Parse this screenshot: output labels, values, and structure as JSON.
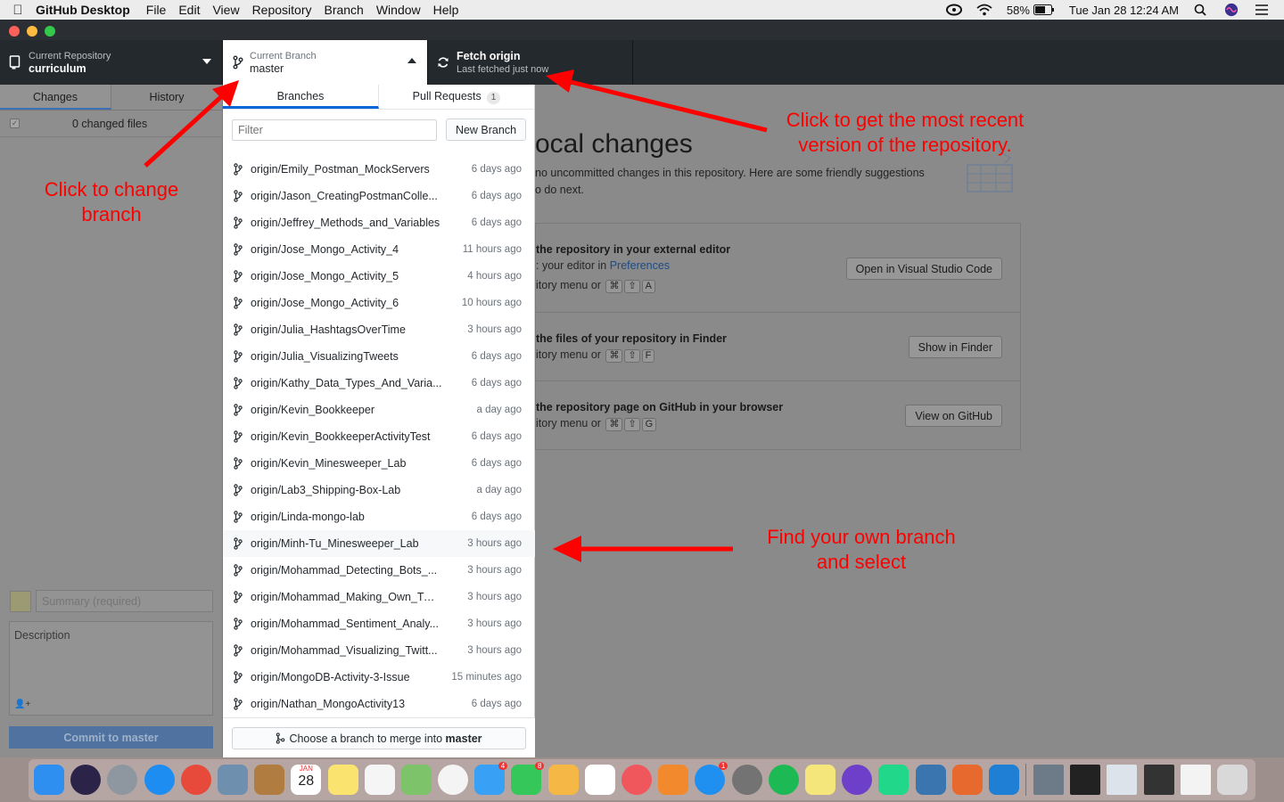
{
  "menubar": {
    "app_name": "GitHub Desktop",
    "menus": [
      "File",
      "Edit",
      "View",
      "Repository",
      "Branch",
      "Window",
      "Help"
    ],
    "battery": "58%",
    "datetime": "Tue Jan 28  12:24 AM"
  },
  "toolbar": {
    "repo_label": "Current Repository",
    "repo_value": "curriculum",
    "branch_label": "Current Branch",
    "branch_value": "master",
    "fetch_title": "Fetch origin",
    "fetch_sub": "Last fetched just now"
  },
  "sidebar": {
    "tab_changes": "Changes",
    "tab_history": "History",
    "changed_files": "0 changed files",
    "summary_placeholder": "Summary (required)",
    "description_placeholder": "Description",
    "commit_button": "Commit to master"
  },
  "content": {
    "title": "ocal changes",
    "desc_line1": "no uncommitted changes in this repository. Here are some friendly suggestions",
    "desc_line2": "o do next.",
    "editor": {
      "title": "the repository in your external editor",
      "line1_prefix": ": your editor in ",
      "line1_link": "Preferences",
      "line2": "itory menu or",
      "keys": [
        "⌘",
        "⇧",
        "A"
      ],
      "button": "Open in Visual Studio Code"
    },
    "finder": {
      "title": "the files of your repository in Finder",
      "line": "itory menu or",
      "keys": [
        "⌘",
        "⇧",
        "F"
      ],
      "button": "Show in Finder"
    },
    "github": {
      "title": "the repository page on GitHub in your browser",
      "line": "itory menu or",
      "keys": [
        "⌘",
        "⇧",
        "G"
      ],
      "button": "View on GitHub"
    }
  },
  "popover": {
    "tab_branches": "Branches",
    "tab_pull_requests": "Pull Requests",
    "pr_count": "1",
    "filter_placeholder": "Filter",
    "new_branch_button": "New Branch",
    "merge_prefix": "Choose a branch to merge into ",
    "merge_target": "master",
    "branches": [
      {
        "name": "origin/Emily_Postman_MockServers",
        "time": "6 days ago"
      },
      {
        "name": "origin/Jason_CreatingPostmanColle...",
        "time": "6 days ago"
      },
      {
        "name": "origin/Jeffrey_Methods_and_Variables",
        "time": "6 days ago"
      },
      {
        "name": "origin/Jose_Mongo_Activity_4",
        "time": "11 hours ago"
      },
      {
        "name": "origin/Jose_Mongo_Activity_5",
        "time": "4 hours ago"
      },
      {
        "name": "origin/Jose_Mongo_Activity_6",
        "time": "10 hours ago"
      },
      {
        "name": "origin/Julia_HashtagsOverTime",
        "time": "3 hours ago"
      },
      {
        "name": "origin/Julia_VisualizingTweets",
        "time": "6 days ago"
      },
      {
        "name": "origin/Kathy_Data_Types_And_Varia...",
        "time": "6 days ago"
      },
      {
        "name": "origin/Kevin_Bookkeeper",
        "time": "a day ago"
      },
      {
        "name": "origin/Kevin_BookkeeperActivityTest",
        "time": "6 days ago"
      },
      {
        "name": "origin/Kevin_Minesweeper_Lab",
        "time": "6 days ago"
      },
      {
        "name": "origin/Lab3_Shipping-Box-Lab",
        "time": "a day ago"
      },
      {
        "name": "origin/Linda-mongo-lab",
        "time": "6 days ago"
      },
      {
        "name": "origin/Minh-Tu_Minesweeper_Lab",
        "time": "3 hours ago"
      },
      {
        "name": "origin/Mohammad_Detecting_Bots_...",
        "time": "3 hours ago"
      },
      {
        "name": "origin/Mohammad_Making_Own_Twi...",
        "time": "3 hours ago"
      },
      {
        "name": "origin/Mohammad_Sentiment_Analy...",
        "time": "3 hours ago"
      },
      {
        "name": "origin/Mohammad_Visualizing_Twitt...",
        "time": "3 hours ago"
      },
      {
        "name": "origin/MongoDB-Activity-3-Issue",
        "time": "15 minutes ago"
      },
      {
        "name": "origin/Nathan_MongoActivity13",
        "time": "6 days ago"
      }
    ]
  },
  "annotations": {
    "change_branch_1": "Click to change",
    "change_branch_2": "branch",
    "fetch_1": "Click to get the most recent",
    "fetch_2": "version of the repository.",
    "find_1": "Find your own branch",
    "find_2": "and select"
  },
  "colors": {
    "annotation": "#fd0000",
    "toolbar": "#24292e",
    "accent": "#0366d6"
  },
  "dock": {
    "calendar_month": "JAN",
    "calendar_day": "28",
    "messages_badge": "4",
    "facetime_badge": "8",
    "appstore_badge": "1"
  }
}
